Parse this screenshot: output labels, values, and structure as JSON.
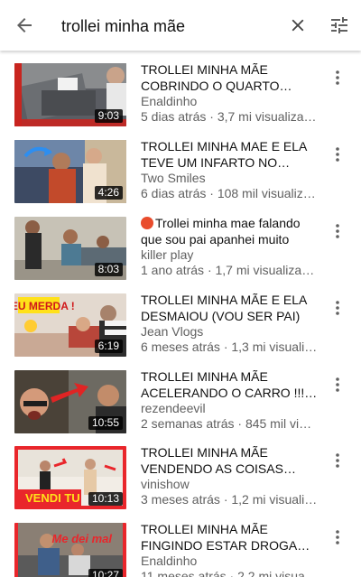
{
  "search": {
    "query": "trollei minha mãe"
  },
  "results": [
    {
      "title": "TROLLEI MINHA MÃE COBRINDO O QUARTO INTEIR…",
      "channel": "Enaldinho",
      "meta": "5 dias atrás · 3,7 mi visualiza…",
      "duration": "9:03",
      "live_dot": false
    },
    {
      "title": "TROLLEI MINHA MAE E ELA TEVE UM INFARTO NO VÍDEO …",
      "channel": "Two Smiles",
      "meta": "6 dias atrás · 108 mil visualiza…",
      "duration": "4:26",
      "live_dot": false
    },
    {
      "title": "Trollei minha mae falando que sou pai apanhei muito",
      "channel": "killer play",
      "meta": "1 ano atrás · 1,7 mi visualizaçõ…",
      "duration": "8:03",
      "live_dot": true
    },
    {
      "title": "TROLLEI MINHA MÃE E ELA DESMAIOU (VOU SER PAI)",
      "channel": "Jean Vlogs",
      "meta": "6 meses atrás · 1,3 mi visualiz…",
      "duration": "6:19",
      "live_dot": false,
      "thumb_text": "DEU MERDA !"
    },
    {
      "title": "TROLLEI MINHA MÃE ACELERANDO O CARRO !!! ( T…",
      "channel": "rezendeevil",
      "meta": "2 semanas atrás · 845 mil visua…",
      "duration": "10:55",
      "live_dot": false
    },
    {
      "title": "TROLLEI MINHA MÃE VENDENDO AS COISAS DELA",
      "channel": "vinishow",
      "meta": "3 meses atrás · 1,2 mi visualiza…",
      "duration": "10:13",
      "live_dot": false,
      "thumb_text": "VENDI TU"
    },
    {
      "title": "TROLLEI MINHA MÃE FINGINDO ESTAR DROGADO E OLHA OQU…",
      "channel": "Enaldinho",
      "meta": "11 meses atrás · 2,2 mi visualiz…",
      "duration": "10:27",
      "live_dot": false,
      "thumb_text": "Me dei mal"
    }
  ],
  "colors": {
    "accent_red": "#e9262b",
    "meta_gray": "#606060",
    "icon_gray": "#606060",
    "live_dot": "#e94c2c"
  },
  "icons": {
    "back": "arrow-left-icon",
    "clear": "close-icon",
    "filter": "filter-sliders-icon",
    "more": "more-vert-icon"
  }
}
